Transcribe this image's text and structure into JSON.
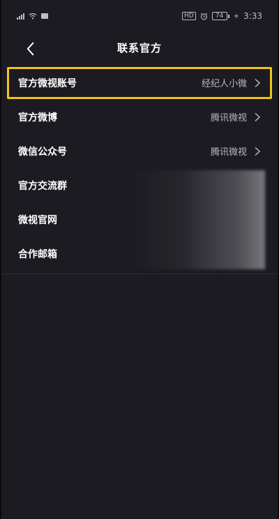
{
  "status_bar": {
    "hd": "HD",
    "battery": "74",
    "time": "3:33"
  },
  "nav": {
    "title": "联系官方"
  },
  "items": [
    {
      "label": "官方微视账号",
      "value": "经纪人小微"
    },
    {
      "label": "官方微博",
      "value": "腾讯微视"
    },
    {
      "label": "微信公众号",
      "value": "腾讯微视"
    },
    {
      "label": "官方交流群",
      "value": ""
    },
    {
      "label": "微视官网",
      "value": ""
    },
    {
      "label": "合作邮箱",
      "value": ""
    }
  ],
  "colors": {
    "background": "#1b1b21",
    "highlight": "#f3c316",
    "text": "#ffffff",
    "secondary_text": "#b9b9bf"
  }
}
